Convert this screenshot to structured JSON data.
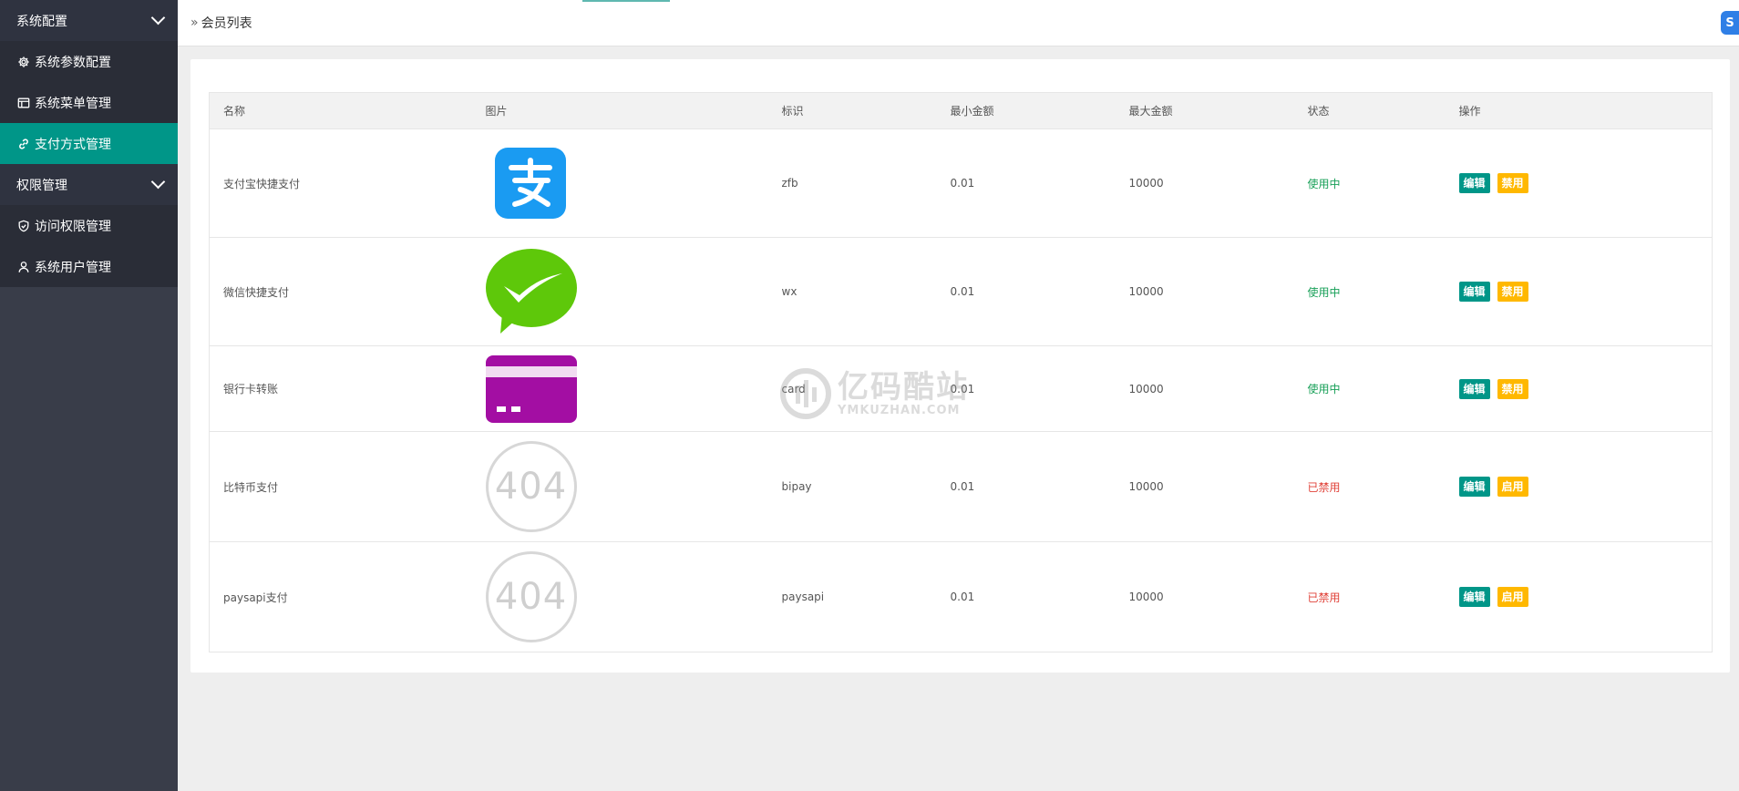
{
  "sidebar": {
    "groups": [
      {
        "label": "系统配置",
        "items": [
          {
            "label": "系统参数配置",
            "icon": "gear-icon"
          },
          {
            "label": "系统菜单管理",
            "icon": "window-icon"
          },
          {
            "label": "支付方式管理",
            "icon": "link-icon",
            "active": true
          }
        ]
      },
      {
        "label": "权限管理",
        "items": [
          {
            "label": "访问权限管理",
            "icon": "shield-check-icon"
          },
          {
            "label": "系统用户管理",
            "icon": "user-icon"
          }
        ]
      }
    ]
  },
  "header": {
    "breadcrumb_icon": "»",
    "breadcrumb": "会员列表",
    "corner_badge": "S"
  },
  "table": {
    "columns": [
      "名称",
      "图片",
      "标识",
      "最小金额",
      "最大金额",
      "状态",
      "操作"
    ],
    "rows": [
      {
        "name": "支付宝快捷支付",
        "image": "alipay-logo",
        "code": "zfb",
        "min": "0.01",
        "max": "10000",
        "status": "使用中",
        "edit": "编辑",
        "toggle": "禁用"
      },
      {
        "name": "微信快捷支付",
        "image": "wechat-logo",
        "code": "wx",
        "min": "0.01",
        "max": "10000",
        "status": "使用中",
        "edit": "编辑",
        "toggle": "禁用"
      },
      {
        "name": "银行卡转账",
        "image": "bank-card-logo",
        "code": "card",
        "min": "0.01",
        "max": "10000",
        "status": "使用中",
        "edit": "编辑",
        "toggle": "禁用"
      },
      {
        "name": "比特币支付",
        "image": "404",
        "code": "bipay",
        "min": "0.01",
        "max": "10000",
        "status": "已禁用",
        "edit": "编辑",
        "toggle": "启用"
      },
      {
        "name": "paysapi支付",
        "image": "404",
        "code": "paysapi",
        "min": "0.01",
        "max": "10000",
        "status": "已禁用",
        "edit": "编辑",
        "toggle": "启用"
      }
    ]
  },
  "watermark": {
    "cn": "亿码酷站",
    "en": "YMKUZHAN.COM"
  },
  "colors": {
    "sidebar_bg": "#393d49",
    "active": "#009688",
    "edit_button": "#009688",
    "toggle_button": "#ffb800",
    "status_on": "#18a058",
    "status_off": "#e0433a"
  }
}
